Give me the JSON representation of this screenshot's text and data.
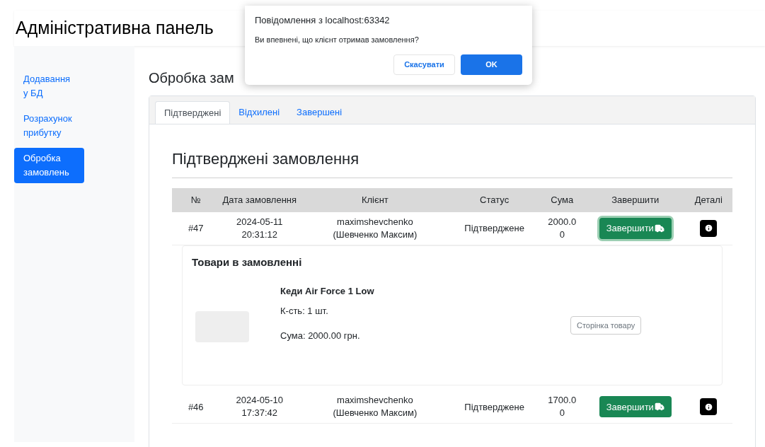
{
  "header": {
    "title": "Адміністративна панель"
  },
  "sidebar": {
    "items": [
      {
        "label": "Додавання у БД",
        "selected": false
      },
      {
        "label": "Розрахунок прибутку",
        "selected": false
      },
      {
        "label": "Обробка замовлень",
        "selected": true
      }
    ]
  },
  "main": {
    "heading": "Обробка зам"
  },
  "tabs": [
    {
      "label": "Підтверджені",
      "selected": true
    },
    {
      "label": "Відхилені",
      "selected": false
    },
    {
      "label": "Завершені",
      "selected": false
    }
  ],
  "section_heading": "Підтверджені замовлення",
  "table": {
    "columns": [
      "№",
      "Дата замовлення",
      "Клієнт",
      "Статус",
      "Сума",
      "Завершити",
      "Деталі"
    ],
    "rows": [
      {
        "number": "#47",
        "date": "2024-05-11",
        "time": "20:31:12",
        "login": "maximshevchenko",
        "name": "(Шевченко Максим)",
        "status": "Підтверджене",
        "sum": "2000.00",
        "complete_label": "Завершити",
        "focused": true,
        "details": {
          "title": "Товари в замовленні",
          "items": [
            {
              "name": "Кеди Air Force 1 Low",
              "quantity": "К-сть: 1 шт.",
              "sum": "Сума: 2000.00 грн.",
              "link": "Сторінка товару"
            }
          ]
        }
      },
      {
        "number": "#46",
        "date": "2024-05-10",
        "time": "17:37:42",
        "login": "maximshevchenko",
        "name": "(Шевченко Максим)",
        "status": "Підтверджене",
        "sum": "1700.00",
        "complete_label": "Завершити",
        "focused": false
      }
    ]
  },
  "dialog": {
    "title": "Повідомлення з localhost:63342",
    "message": "Ви впевнені, що клієнт отримав замовлення?",
    "buttons": [
      {
        "label": "Скасувати",
        "kind": "secondary"
      },
      {
        "label": "OK",
        "kind": "primary"
      }
    ]
  }
}
